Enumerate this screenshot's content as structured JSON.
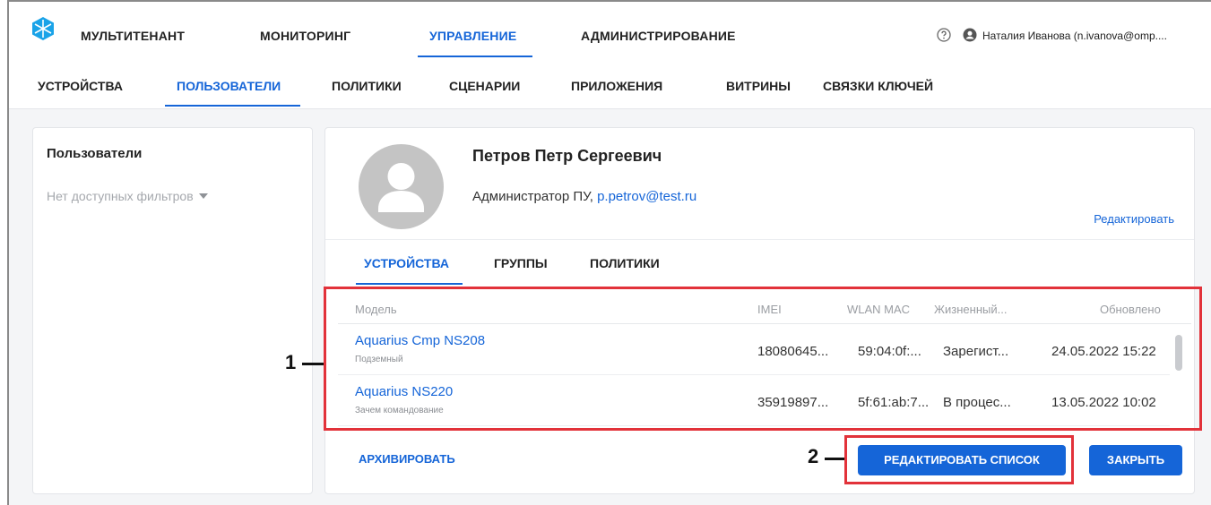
{
  "topnav": {
    "items": [
      "МУЛЬТИТЕНАНТ",
      "МОНИТОРИНГ",
      "УПРАВЛЕНИЕ",
      "АДМИНИСТРИРОВАНИЕ"
    ],
    "active": "УПРАВЛЕНИЕ",
    "user": "Наталия Иванова (n.ivanova@omp...."
  },
  "subnav": {
    "items": [
      "УСТРОЙСТВА",
      "ПОЛЬЗОВАТЕЛИ",
      "ПОЛИТИКИ",
      "СЦЕНАРИИ",
      "ПРИЛОЖЕНИЯ",
      "ВИТРИНЫ",
      "СВЯЗКИ КЛЮЧЕЙ"
    ],
    "active": "ПОЛЬЗОВАТЕЛИ"
  },
  "left_panel": {
    "title": "Пользователи",
    "filter": "Нет доступных фильтров"
  },
  "profile": {
    "name": "Петров Петр Сергеевич",
    "role": "Администратор ПУ,",
    "email": "p.petrov@test.ru",
    "edit": "Редактировать"
  },
  "tabs": {
    "items": [
      "УСТРОЙСТВА",
      "ГРУППЫ",
      "ПОЛИТИКИ"
    ],
    "active": "УСТРОЙСТВА"
  },
  "table": {
    "columns": [
      "Модель",
      "IMEI",
      "WLAN MAC",
      "Жизненный...",
      "Обновлено"
    ],
    "rows": [
      {
        "model": "Aquarius Cmp NS208",
        "subtitle": "Подземный",
        "imei": "18080645...",
        "mac": "59:04:0f:...",
        "lifecycle": "Зарегист...",
        "updated": "24.05.2022 15:22"
      },
      {
        "model": "Aquarius NS220",
        "subtitle": "Зачем командование",
        "imei": "35919897...",
        "mac": "5f:61:ab:7...",
        "lifecycle": "В процес...",
        "updated": "13.05.2022 10:02"
      }
    ]
  },
  "actions": {
    "archive": "АРХИВИРОВАТЬ",
    "edit_list": "РЕДАКТИРОВАТЬ СПИСОК",
    "close": "ЗАКРЫТЬ"
  },
  "annotations": {
    "one": "1",
    "two": "2",
    "color": "#e2323a"
  },
  "colors": {
    "accent": "#1565d8",
    "background": "#f4f5f7"
  }
}
